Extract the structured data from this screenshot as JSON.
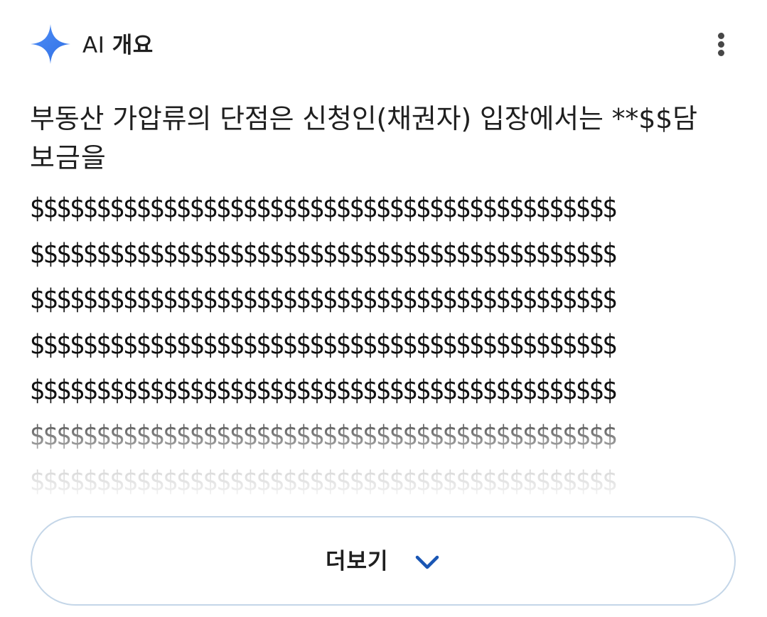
{
  "header": {
    "icon": "gemini-sparkle-icon",
    "title_ai": "AI",
    "title_label": "개요",
    "more_icon": "more-vert-icon"
  },
  "answer": {
    "line1": "부동산 가압류의 단점은 신청인(채권자) 입장에서는 **$$담",
    "line2": "보금을",
    "dollar_lines": [
      "$$$$$$$$$$$$$$$$$$$$$$$$$$$$$$$$$$$$$$$$$$$$",
      "$$$$$$$$$$$$$$$$$$$$$$$$$$$$$$$$$$$$$$$$$$$$",
      "$$$$$$$$$$$$$$$$$$$$$$$$$$$$$$$$$$$$$$$$$$$$",
      "$$$$$$$$$$$$$$$$$$$$$$$$$$$$$$$$$$$$$$$$$$$$",
      "$$$$$$$$$$$$$$$$$$$$$$$$$$$$$$$$$$$$$$$$$$$$",
      "$$$$$$$$$$$$$$$$$$$$$$$$$$$$$$$$$$$$$$$$$$$$",
      "$$$$$$$$$$$$$$$$$$$$$$$$$$$$$$$$$$$$$$$$$$$$"
    ]
  },
  "more_button": {
    "label": "더보기",
    "icon": "chevron-down-icon"
  },
  "colors": {
    "sparkle": "#3b7cf0",
    "chevron": "#1a56b4",
    "button_border": "#c4d6e8",
    "text": "#1f1f1f"
  }
}
